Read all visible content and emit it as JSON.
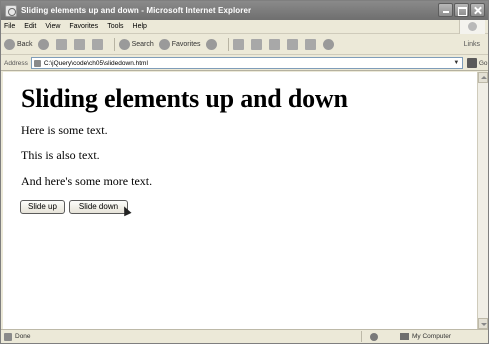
{
  "window": {
    "title": "Sliding elements up and down - Microsoft Internet Explorer"
  },
  "menubar": {
    "items": [
      "File",
      "Edit",
      "View",
      "Favorites",
      "Tools",
      "Help"
    ]
  },
  "toolbar": {
    "back_label": "Back",
    "search_label": "Search",
    "favorites_label": "Favorites",
    "links_label": "Links"
  },
  "addressbar": {
    "label": "Address",
    "url": "C:\\jQuery\\code\\ch05\\slidedown.html",
    "go_label": "Go"
  },
  "page": {
    "heading": "Sliding elements up and down",
    "paragraphs": [
      "Here is some text.",
      "This is also text.",
      "And here's some more text."
    ],
    "buttons": {
      "slide_up": "Slide up",
      "slide_down": "Slide down"
    }
  },
  "statusbar": {
    "status": "Done",
    "zone": "My Computer"
  }
}
